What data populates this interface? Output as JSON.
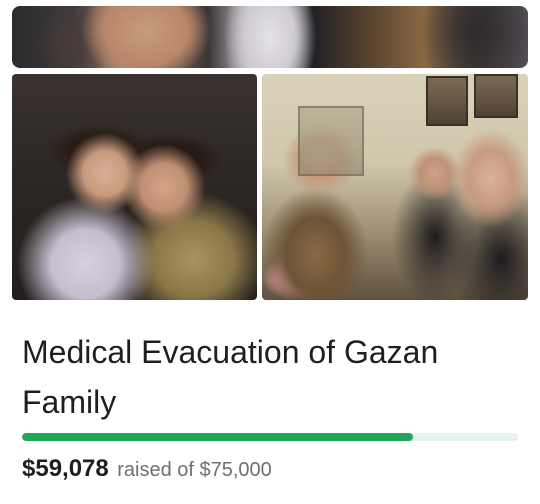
{
  "campaign": {
    "title": "Medical Evacuation of Gazan Family",
    "amount_raised": "$59,078",
    "raised_of_text": "raised of $75,000",
    "goal": "$75,000",
    "progress_fraction": 0.7877,
    "progress_color": "#1fa85a",
    "track_color": "#e9f3ee"
  },
  "photos": [
    {
      "id": "top",
      "icon": "campaign-photo"
    },
    {
      "id": "children",
      "icon": "campaign-photo"
    },
    {
      "id": "family",
      "icon": "campaign-photo"
    }
  ]
}
